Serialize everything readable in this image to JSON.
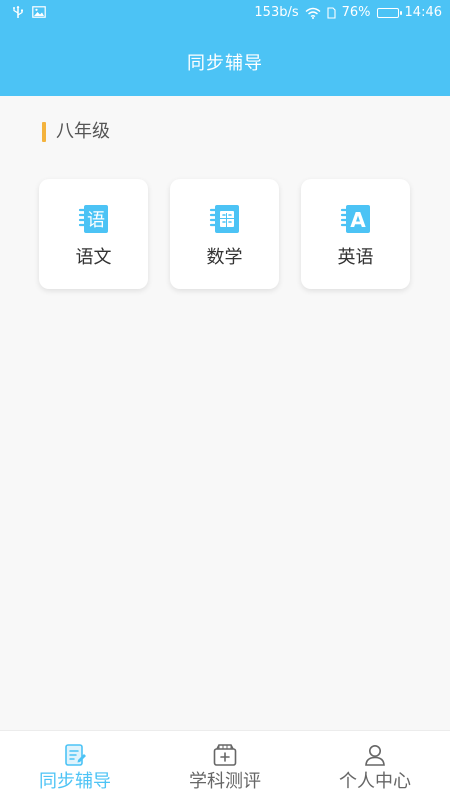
{
  "status_bar": {
    "network_speed": "153b/s",
    "battery_percent": "76%",
    "battery_level": 0.76,
    "time": "14:46",
    "icons": [
      "usb-icon",
      "image-icon",
      "wifi-icon",
      "sim-icon",
      "battery-icon"
    ]
  },
  "header": {
    "title": "同步辅导"
  },
  "section": {
    "title": "八年级",
    "accent_color": "#f4b33d"
  },
  "subjects": [
    {
      "label": "语文",
      "icon": "chinese-book-icon",
      "glyph": "语"
    },
    {
      "label": "数学",
      "icon": "math-book-icon",
      "glyph": "calculator"
    },
    {
      "label": "英语",
      "icon": "english-book-icon",
      "glyph": "A"
    }
  ],
  "bottom_nav": {
    "items": [
      {
        "label": "同步辅导",
        "icon": "document-edit-icon",
        "active": true
      },
      {
        "label": "学科测评",
        "icon": "test-box-icon",
        "active": false
      },
      {
        "label": "个人中心",
        "icon": "user-icon",
        "active": false
      }
    ]
  },
  "colors": {
    "primary": "#4cc3f5",
    "text_dark": "#333333",
    "text_muted": "#666666",
    "background": "#f8f8f8"
  }
}
